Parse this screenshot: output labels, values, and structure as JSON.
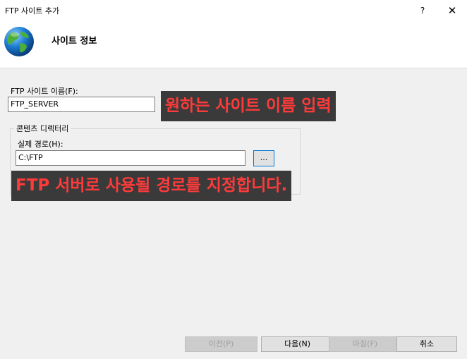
{
  "window": {
    "title": "FTP 사이트 추가",
    "help_glyph": "?",
    "close_glyph": "✕"
  },
  "header": {
    "title": "사이트 정보",
    "icon": "globe-icon"
  },
  "form": {
    "site_name_label": "FTP 사이트 이름(F):",
    "site_name_value": "FTP_SERVER",
    "content_dir_group": "콘텐츠 디렉터리",
    "physical_path_label": "실제 경로(H):",
    "physical_path_value": "C:\\FTP",
    "browse_label": "..."
  },
  "annotations": {
    "site_name_hint": "원하는 사이트 이름 입력",
    "path_hint": "FTP 서버로 사용될 경로를 지정합니다."
  },
  "footer": {
    "prev_label": "이전(P)",
    "next_label": "다음(N)",
    "finish_label": "마침(F)",
    "cancel_label": "취소"
  },
  "colors": {
    "annotation_bg": "#3a3a3a",
    "annotation_text": "#ff3a3a",
    "focus_border": "#0078d7"
  }
}
